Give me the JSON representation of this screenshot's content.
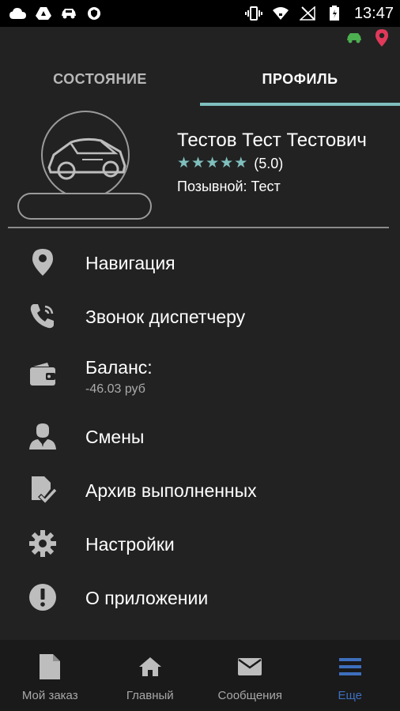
{
  "status_bar": {
    "time": "13:47",
    "left_icons": [
      "cloud-icon",
      "drive-icon",
      "car-icon",
      "shield-icon"
    ],
    "right_icons": [
      "vibrate-icon",
      "wifi-icon",
      "no-signal-icon",
      "battery-icon"
    ]
  },
  "indicators": [
    {
      "icon": "car-icon",
      "color": "#4caf50"
    },
    {
      "icon": "location-pin-icon",
      "color": "#e0395a"
    }
  ],
  "tabs": [
    {
      "label": "СОСТОЯНИЕ",
      "active": false
    },
    {
      "label": "ПРОФИЛЬ",
      "active": true
    }
  ],
  "profile": {
    "name": "Тестов Тест Тестович",
    "rating": "(5.0)",
    "stars": 5,
    "callsign_label": "Позывной:",
    "callsign_value": "Тест"
  },
  "menu": [
    {
      "label": "Навигация",
      "icon": "location-pin-icon"
    },
    {
      "label": "Звонок диспетчеру",
      "icon": "phone-ringing-icon"
    },
    {
      "label": "Баланс:",
      "sub": "-46.03 руб",
      "icon": "wallet-icon"
    },
    {
      "label": "Смены",
      "icon": "person-icon"
    },
    {
      "label": "Архив выполненных",
      "icon": "document-check-icon"
    },
    {
      "label": "Настройки",
      "icon": "gear-icon"
    },
    {
      "label": "О приложении",
      "icon": "info-icon"
    }
  ],
  "bottom_nav": [
    {
      "label": "Мой заказ",
      "icon": "document-icon",
      "active": false
    },
    {
      "label": "Главный",
      "icon": "home-icon",
      "active": false
    },
    {
      "label": "Сообщения",
      "icon": "mail-icon",
      "active": false
    },
    {
      "label": "Еще",
      "icon": "menu-icon",
      "active": true
    }
  ],
  "colors": {
    "accent": "#7fbfbd",
    "active_nav": "#3e6fbe",
    "background": "#222222"
  }
}
